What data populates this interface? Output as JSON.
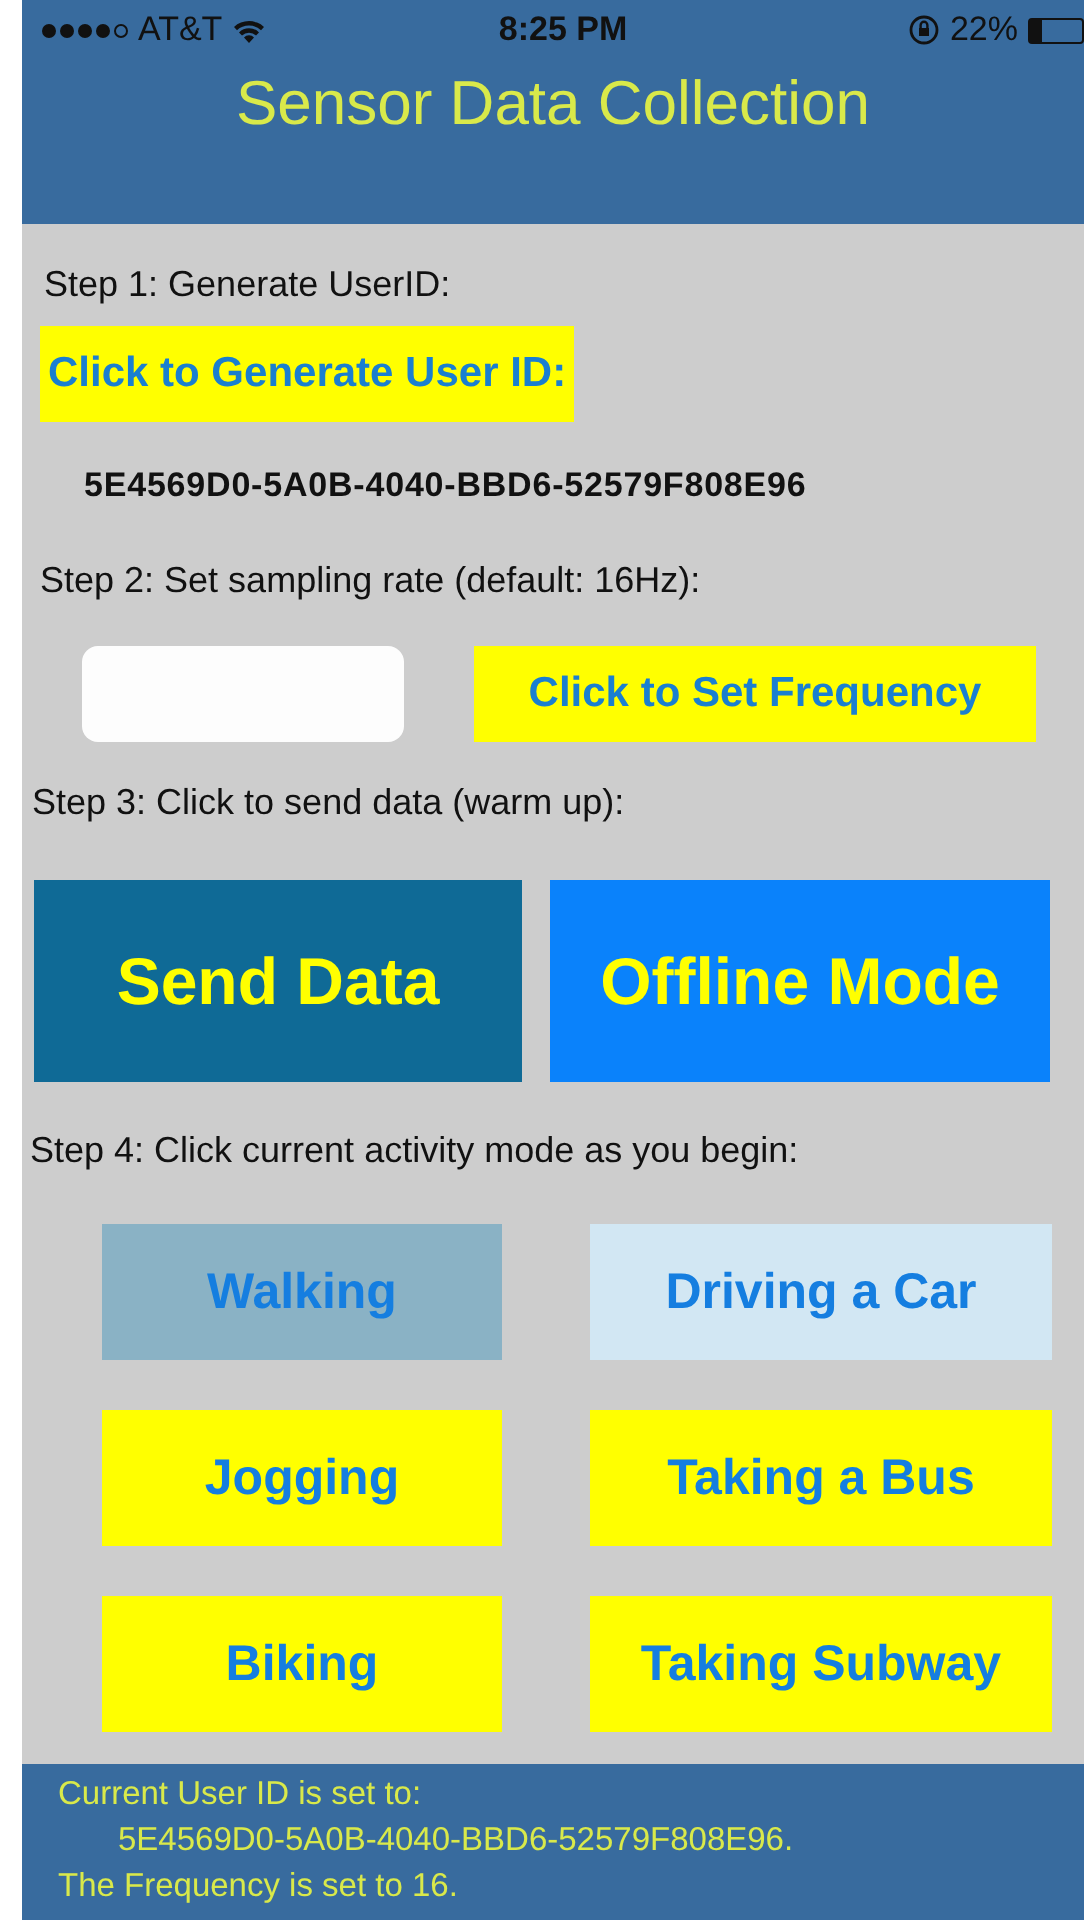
{
  "status_bar": {
    "carrier": "AT&T",
    "time": "8:25 PM",
    "battery": "22%"
  },
  "header": {
    "title": "Sensor Data Collection"
  },
  "step1": {
    "label": "Step 1: Generate UserID:",
    "button": "Click to Generate User ID:",
    "user_id": "5E4569D0-5A0B-4040-BBD6-52579F808E96"
  },
  "step2": {
    "label": "Step 2: Set sampling rate (default: 16Hz):",
    "button": "Click to Set Frequency"
  },
  "step3": {
    "label": "Step 3: Click to send data (warm up):",
    "buttons": [
      {
        "label": "Send Data",
        "kind": "dark"
      },
      {
        "label": "Offline Mode",
        "kind": "bright"
      }
    ]
  },
  "step4": {
    "label": "Step 4: Click current activity mode as you begin:",
    "activities": [
      {
        "label": "Walking",
        "kind": "pressed"
      },
      {
        "label": "Driving a Car",
        "kind": "light"
      },
      {
        "label": "Jogging",
        "kind": "plain"
      },
      {
        "label": "Taking a Bus",
        "kind": "plain"
      },
      {
        "label": "Biking",
        "kind": "plain"
      },
      {
        "label": "Taking Subway",
        "kind": "plain"
      }
    ]
  },
  "footer": {
    "lines": [
      "Current User ID is set to:",
      "5E4569D0-5A0B-4040-BBD6-52579F808E96.",
      "The Frequency is set to 16."
    ]
  }
}
